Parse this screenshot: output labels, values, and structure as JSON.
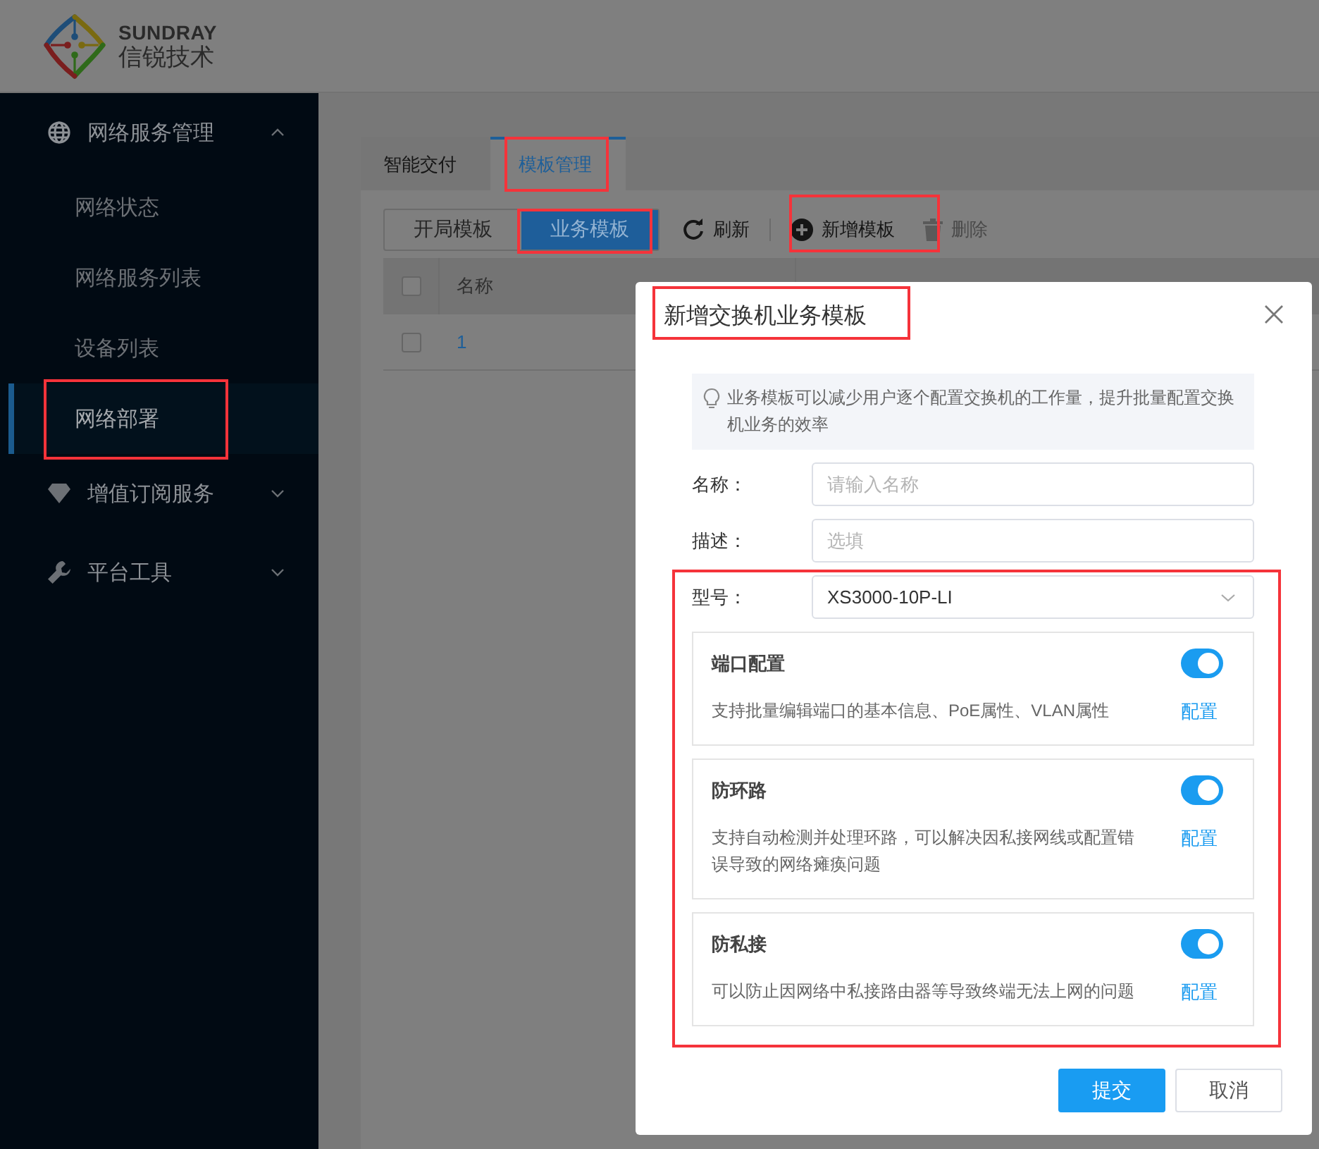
{
  "brand": {
    "name": "SUNDRAY",
    "subtitle": "信锐技术"
  },
  "sidebar": {
    "groups": [
      {
        "label": "网络服务管理",
        "kind": "globe",
        "expanded": true,
        "children": [
          {
            "label": "网络状态",
            "selected": false
          },
          {
            "label": "网络服务列表",
            "selected": false
          },
          {
            "label": "设备列表",
            "selected": false
          },
          {
            "label": "网络部署",
            "selected": true
          }
        ]
      },
      {
        "label": "增值订阅服务",
        "kind": "diamond",
        "expanded": false
      },
      {
        "label": "平台工具",
        "kind": "wrench",
        "expanded": false
      }
    ]
  },
  "tabs": [
    {
      "label": "智能交付",
      "selected": false
    },
    {
      "label": "模板管理",
      "selected": true
    }
  ],
  "segments": [
    {
      "label": "开局模板",
      "selected": false
    },
    {
      "label": "业务模板",
      "selected": true
    }
  ],
  "toolbar": [
    {
      "label": "刷新",
      "kind": "refresh",
      "disabled": false
    },
    {
      "label": "新增模板",
      "kind": "add",
      "disabled": false
    },
    {
      "label": "删除",
      "kind": "delete",
      "disabled": true
    }
  ],
  "table": {
    "header_checked": false,
    "columns": [
      "名称"
    ],
    "rows": [
      {
        "name": "1",
        "checked": false
      }
    ]
  },
  "dialog": {
    "title": "新增交换机业务模板",
    "tip": "业务模板可以减少用户逐个配置交换机的工作量，提升批量配置交换机业务的效率",
    "fields": [
      {
        "label": "名称：",
        "kind": "input",
        "placeholder": "请输入名称"
      },
      {
        "label": "描述：",
        "kind": "input",
        "placeholder": "选填"
      },
      {
        "label": "型号：",
        "kind": "select",
        "value": "XS3000-10P-LI"
      }
    ],
    "features": [
      {
        "title": "端口配置",
        "on": true,
        "description": "支持批量编辑端口的基本信息、PoE属性、VLAN属性",
        "link": "配置"
      },
      {
        "title": "防环路",
        "on": true,
        "description": "支持自动检测并处理环路，可以解决因私接网线或配置错误导致的网络瘫痪问题",
        "link": "配置"
      },
      {
        "title": "防私接",
        "on": true,
        "description": "可以防止因网络中私接路由器等导致终端无法上网的问题",
        "link": "配置"
      }
    ],
    "buttons": [
      {
        "label": "提交",
        "kind": "primary"
      },
      {
        "label": "取消",
        "kind": "default"
      }
    ]
  }
}
